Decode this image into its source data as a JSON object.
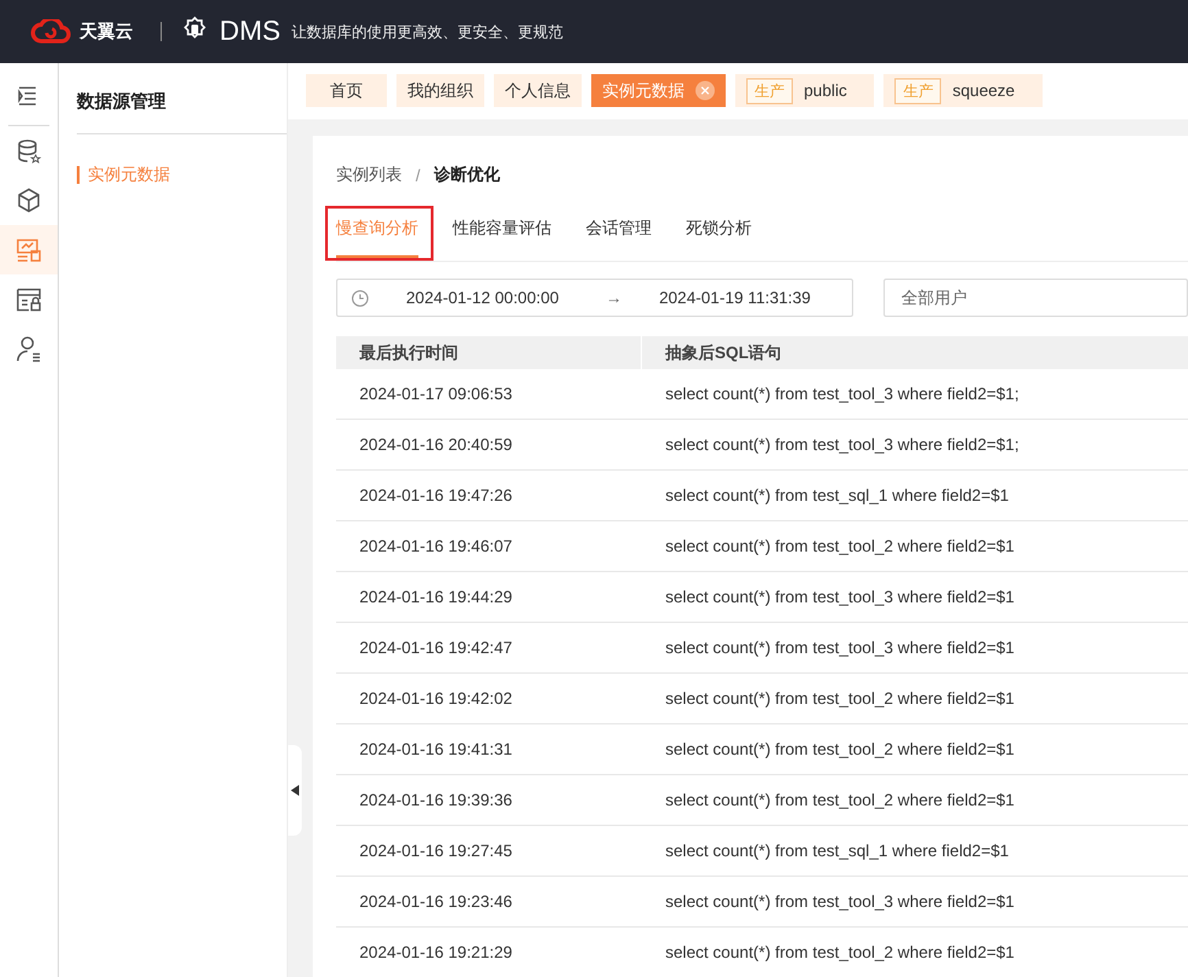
{
  "header": {
    "brand": "天翼云",
    "product": "DMS",
    "slogan": "让数据库的使用更高效、更安全、更规范"
  },
  "rail": [
    {
      "kind": "menu",
      "selected": false
    },
    {
      "kind": "database",
      "selected": false
    },
    {
      "kind": "cube",
      "selected": false
    },
    {
      "kind": "monitor",
      "selected": true
    },
    {
      "kind": "lock",
      "selected": false
    },
    {
      "kind": "user",
      "selected": false
    }
  ],
  "sidebar": {
    "title": "数据源管理",
    "items": [
      {
        "label": "实例元数据",
        "selected": true
      }
    ]
  },
  "tabs": [
    {
      "label": "首页",
      "selected": false
    },
    {
      "label": "我的组织",
      "selected": false
    },
    {
      "label": "个人信息",
      "selected": false
    },
    {
      "label": "实例元数据",
      "selected": true
    },
    {
      "tag": "生产",
      "label": "public",
      "selected": false
    },
    {
      "tag": "生产",
      "label": "squeeze",
      "selected": false
    }
  ],
  "breadcrumb": {
    "parent": "实例列表",
    "separator": "/",
    "current": "诊断优化"
  },
  "subtabs": [
    {
      "label": "慢查询分析",
      "selected": true,
      "highlighted": true
    },
    {
      "label": "性能容量评估",
      "selected": false,
      "highlighted": false
    },
    {
      "label": "会话管理",
      "selected": false,
      "highlighted": false
    },
    {
      "label": "死锁分析",
      "selected": false,
      "highlighted": false
    }
  ],
  "date_range": {
    "start": "2024-01-12 00:00:00",
    "separator": "→",
    "end": "2024-01-19 11:31:39"
  },
  "user_select": {
    "placeholder": "全部用户"
  },
  "table": {
    "columns": [
      "最后执行时间",
      "抽象后SQL语句"
    ],
    "rows": [
      [
        "2024-01-17 09:06:53",
        "select count(*) from test_tool_3 where field2=$1;"
      ],
      [
        "2024-01-16 20:40:59",
        "select count(*) from test_tool_3 where field2=$1;"
      ],
      [
        "2024-01-16 19:47:26",
        "select count(*) from test_sql_1 where field2=$1"
      ],
      [
        "2024-01-16 19:46:07",
        "select count(*) from test_tool_2 where field2=$1"
      ],
      [
        "2024-01-16 19:44:29",
        "select count(*) from test_tool_3 where field2=$1"
      ],
      [
        "2024-01-16 19:42:47",
        "select count(*) from test_tool_3 where field2=$1"
      ],
      [
        "2024-01-16 19:42:02",
        "select count(*) from test_tool_2 where field2=$1"
      ],
      [
        "2024-01-16 19:41:31",
        "select count(*) from test_tool_2 where field2=$1"
      ],
      [
        "2024-01-16 19:39:36",
        "select count(*) from test_tool_2 where field2=$1"
      ],
      [
        "2024-01-16 19:27:45",
        "select count(*) from test_sql_1 where field2=$1"
      ],
      [
        "2024-01-16 19:23:46",
        "select count(*) from test_tool_3 where field2=$1"
      ],
      [
        "2024-01-16 19:21:29",
        "select count(*) from test_tool_2 where field2=$1"
      ]
    ]
  }
}
